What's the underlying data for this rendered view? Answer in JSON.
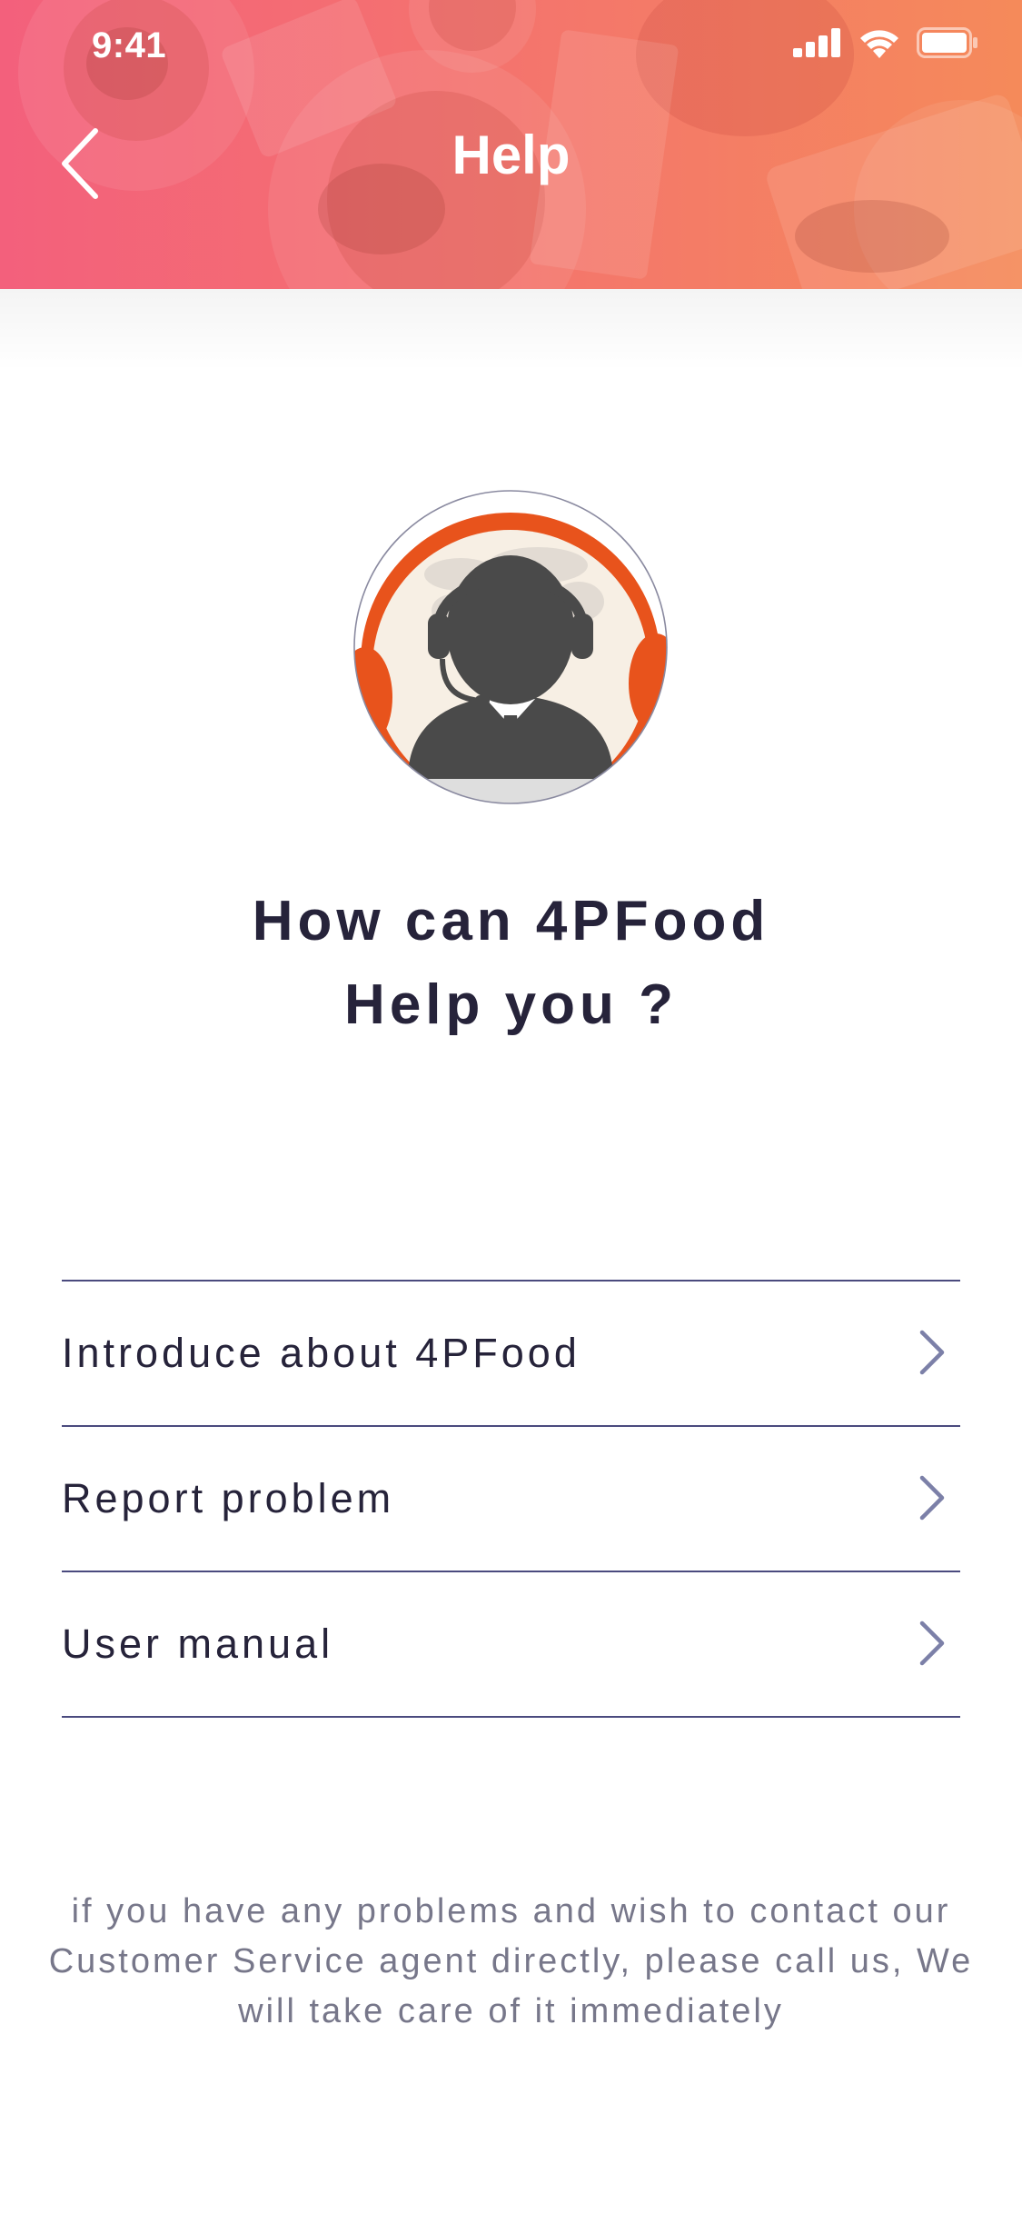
{
  "status_bar": {
    "time": "9:41",
    "icons": [
      "signal-icon",
      "wifi-icon",
      "battery-icon"
    ]
  },
  "header": {
    "title": "Help",
    "back_icon": "chevron-left-icon"
  },
  "hero": {
    "avatar": "customer-support-agent",
    "title_line1": "How can 4PFood",
    "title_line2": "Help you ?"
  },
  "menu": {
    "items": [
      {
        "label": "Introduce about 4PFood",
        "icon": "chevron-right-icon"
      },
      {
        "label": "Report problem",
        "icon": "chevron-right-icon"
      },
      {
        "label": "User manual",
        "icon": "chevron-right-icon"
      }
    ]
  },
  "footer": {
    "note": "if you have any problems and wish to contact our Customer Service agent directly, please call us, We will take care of it immediately"
  },
  "colors": {
    "header_gradient_start": "#f3607c",
    "header_gradient_end": "#f58a5a",
    "text_dark": "#26233a",
    "divider": "#4a4a7e",
    "chevron": "#7c80a8",
    "footer_text": "#77778a",
    "avatar_accent": "#e8531c"
  }
}
